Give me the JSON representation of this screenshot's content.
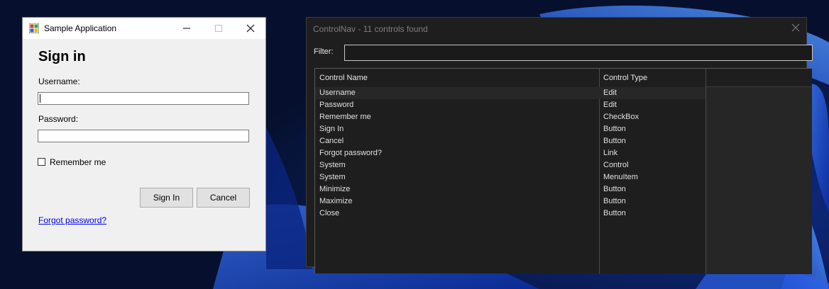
{
  "app_window": {
    "title": "Sample Application",
    "heading": "Sign in",
    "username_label": "Username:",
    "username_value": "",
    "password_label": "Password:",
    "password_value": "",
    "remember_label": "Remember me",
    "remember_checked": false,
    "signin_label": "Sign In",
    "cancel_label": "Cancel",
    "forgot_link": "Forgot password?",
    "icons": [
      "app-icon",
      "minimize-icon",
      "maximize-icon",
      "close-icon"
    ]
  },
  "controlnav": {
    "title": "ControlNav - 11 controls found",
    "filter_label": "Filter:",
    "filter_value": "",
    "columns": [
      "Control Name",
      "Control Type"
    ],
    "rows": [
      {
        "name": "Username",
        "type": "Edit"
      },
      {
        "name": "Password",
        "type": "Edit"
      },
      {
        "name": "Remember me",
        "type": "CheckBox"
      },
      {
        "name": "Sign In",
        "type": "Button"
      },
      {
        "name": "Cancel",
        "type": "Button"
      },
      {
        "name": "Forgot password?",
        "type": "Link"
      },
      {
        "name": "System",
        "type": "Control"
      },
      {
        "name": "System",
        "type": "MenuItem"
      },
      {
        "name": "Minimize",
        "type": "Button"
      },
      {
        "name": "Maximize",
        "type": "Button"
      },
      {
        "name": "Close",
        "type": "Button"
      }
    ],
    "selected_row": 0
  },
  "colors": {
    "desktop_bg": "#06102e",
    "wallpaper_blue": "#1a4fd6",
    "app_bg": "#f0f0f0",
    "link_color": "#0000ee",
    "nav_bg": "#1e1e1e",
    "nav_selected_row": "#272727"
  }
}
